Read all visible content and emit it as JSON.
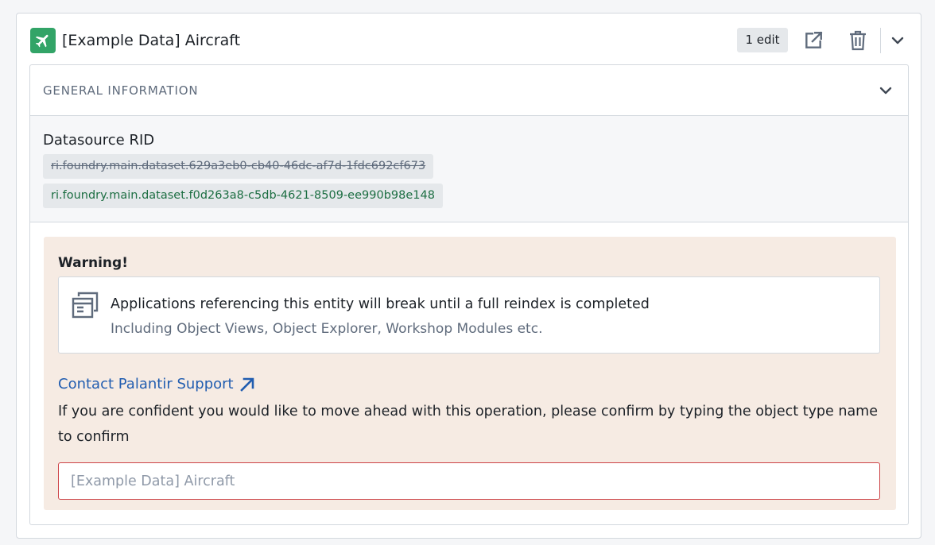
{
  "header": {
    "title": "[Example Data] Aircraft",
    "icon": "airplane-icon",
    "edit_badge": "1 edit",
    "accent_color": "#32a467"
  },
  "general_information": {
    "section_title": "GENERAL INFORMATION",
    "datasource_label": "Datasource RID",
    "old_rid": "ri.foundry.main.dataset.629a3eb0-cb40-46dc-af7d-1fdc692cf673",
    "new_rid": "ri.foundry.main.dataset.f0d263a8-c5db-4621-8509-ee990b98e148"
  },
  "warning": {
    "title": "Warning!",
    "message": "Applications referencing this entity will break until a full reindex is completed",
    "detail": "Including Object Views, Object Explorer, Workshop Modules etc.",
    "support_link": "Contact Palantir Support",
    "confirm_text": "If you are confident you would like to move ahead with this operation, please confirm by typing the object type name to confirm",
    "input_placeholder": "[Example Data] Aircraft",
    "input_value": ""
  }
}
